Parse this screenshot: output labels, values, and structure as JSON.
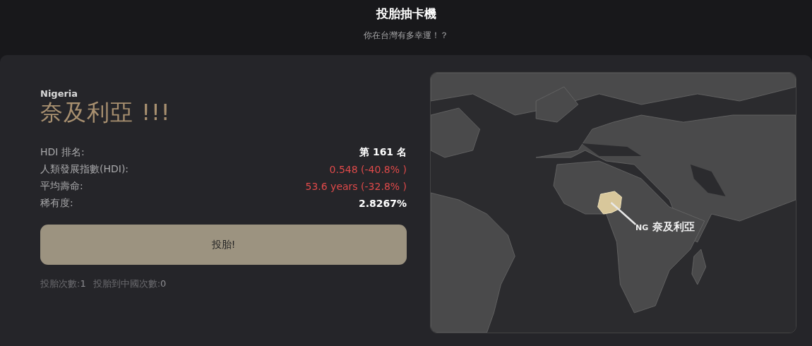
{
  "header": {
    "title": "投胎抽卡機",
    "subtitle": "你在台灣有多幸運！？"
  },
  "result": {
    "name_en": "Nigeria",
    "name": "奈及利亞 !!!"
  },
  "stats": [
    {
      "label": "HDI 排名:",
      "value": "第 161 名",
      "kind": "neutral"
    },
    {
      "label": "人類發展指數(HDI):",
      "value": "0.548 (-40.8% )",
      "kind": "negative"
    },
    {
      "label": "平均壽命:",
      "value": "53.6 years (-32.8% )",
      "kind": "negative"
    },
    {
      "label": "稀有度:",
      "value": "2.8267%",
      "kind": "neutral"
    }
  ],
  "roll_button": "投胎!",
  "counters": [
    {
      "label": "投胎次數:",
      "value": "1"
    },
    {
      "label": "投胎到中國次數:",
      "value": "0"
    }
  ],
  "map": {
    "kind": "picture",
    "marker": {
      "code": "NG",
      "name": "奈及利亞"
    }
  }
}
